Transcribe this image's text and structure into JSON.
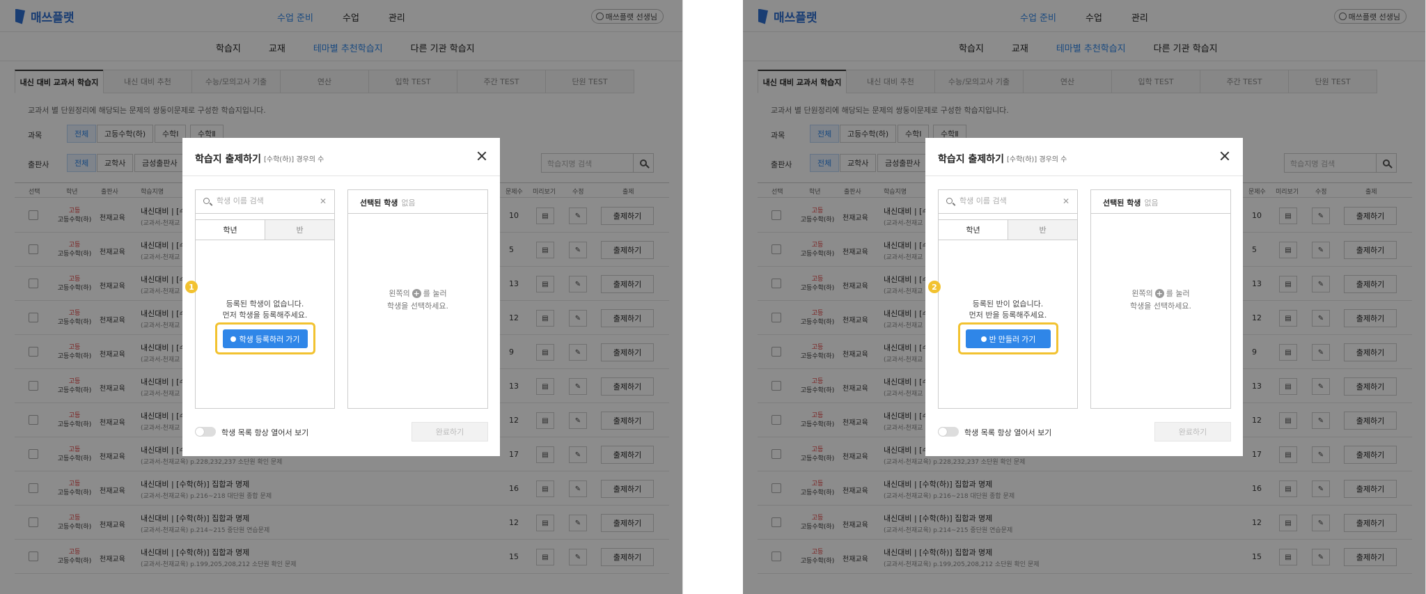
{
  "app": {
    "logo": "매쓰플랫",
    "nav": [
      "수업 준비",
      "수업",
      "관리"
    ],
    "user": "매쓰플랫 선생님",
    "subnav": [
      "학습지",
      "교재",
      "테마별 추천학습지",
      "다른 기관 학습지"
    ]
  },
  "tabs": [
    "내신 대비 교과서 학습지",
    "내신 대비 추천",
    "수능/모의고사 기출",
    "연산",
    "입학 TEST",
    "주간 TEST",
    "단원 TEST"
  ],
  "description": "교과서 별 단원정리에 해당되는 문제의 쌍둥이문제로 구성한 학습지입니다.",
  "filters": {
    "subject_label": "과목",
    "subjects": [
      "전체",
      "고등수학(하)",
      "수학Ⅰ",
      "수학Ⅱ"
    ],
    "publisher_label": "출판사",
    "publishers": [
      "전체",
      "교학사",
      "금성출판사"
    ],
    "search_placeholder": "학습지명 검색"
  },
  "table": {
    "headers": [
      "선택",
      "학년",
      "출판사",
      "학습지명",
      "문제수",
      "미리보기",
      "수정",
      "출제"
    ],
    "action_label": "출제하기",
    "rows": [
      {
        "grade": "고등",
        "course": "고등수학(하)",
        "publisher": "천재교육",
        "title": "내신대비 | [수",
        "sub": "(교과서-천재교",
        "count": "10"
      },
      {
        "grade": "고등",
        "course": "고등수학(하)",
        "publisher": "천재교육",
        "title": "내신대비 | [수",
        "sub": "(교과서-천재교",
        "count": "5"
      },
      {
        "grade": "고등",
        "course": "고등수학(하)",
        "publisher": "천재교육",
        "title": "내신대비 | [수",
        "sub": "(교과서-천재교",
        "count": "13"
      },
      {
        "grade": "고등",
        "course": "고등수학(하)",
        "publisher": "천재교육",
        "title": "내신대비 | [수",
        "sub": "(교과서-천재교",
        "count": "12"
      },
      {
        "grade": "고등",
        "course": "고등수학(하)",
        "publisher": "천재교육",
        "title": "내신대비 | [수",
        "sub": "(교과서-천재교",
        "count": "9"
      },
      {
        "grade": "고등",
        "course": "고등수학(하)",
        "publisher": "천재교육",
        "title": "내신대비 | [수",
        "sub": "(교과서-천재교",
        "count": "13"
      },
      {
        "grade": "고등",
        "course": "고등수학(하)",
        "publisher": "천재교육",
        "title": "내신대비 | [수",
        "sub": "(교과서-천재교",
        "count": "12"
      },
      {
        "grade": "고등",
        "course": "고등수학(하)",
        "publisher": "천재교육",
        "title": "내신대비 | [수",
        "sub": "(교과서-천재교육) p.228,232,237 소단원 확인 문제",
        "count": "17"
      },
      {
        "grade": "고등",
        "course": "고등수학(하)",
        "publisher": "천재교육",
        "title": "내신대비 | [수학(하)] 집합과 명제",
        "sub": "(교과서-천재교육) p.216~218 대단원 종합 문제",
        "count": "16"
      },
      {
        "grade": "고등",
        "course": "고등수학(하)",
        "publisher": "천재교육",
        "title": "내신대비 | [수학(하)] 집합과 명제",
        "sub": "(교과서-천재교육) p.214~215 중단원 연습문제",
        "count": "12"
      },
      {
        "grade": "고등",
        "course": "고등수학(하)",
        "publisher": "천재교육",
        "title": "내신대비 | [수학(하)] 집합과 명제",
        "sub": "(교과서-천재교육) p.199,205,208,212 소단원 확인 문제",
        "count": "15"
      }
    ]
  },
  "modal": {
    "title": "학습지 출제하기",
    "subtitle": "[수학(하)] 경우의 수",
    "search_placeholder": "학생 이름 검색",
    "seg_grade": "학년",
    "seg_class": "반",
    "selected_label": "선택된 학생",
    "selected_empty": "없음",
    "right_hint_1a": "왼쪽의",
    "right_hint_1b": "를 눌러",
    "right_hint_2": "학생을 선택하세요.",
    "toggle_label": "학생 목록 항상 열어서 보기",
    "done_label": "완료하기"
  },
  "left_modal": {
    "step": "1",
    "empty_line1": "등록된 학생이 없습니다.",
    "empty_line2": "먼저 학생을 등록해주세요.",
    "cta": "학생 등록하러 가기"
  },
  "right_modal": {
    "step": "2",
    "empty_line1": "등록된 반이 없습니다.",
    "empty_line2": "먼저 반을 등록해주세요.",
    "cta": "반 만들러 가기"
  },
  "colors": {
    "accent": "#2f86e8",
    "highlight": "#f2c230",
    "grade_red": "#dd3333"
  }
}
